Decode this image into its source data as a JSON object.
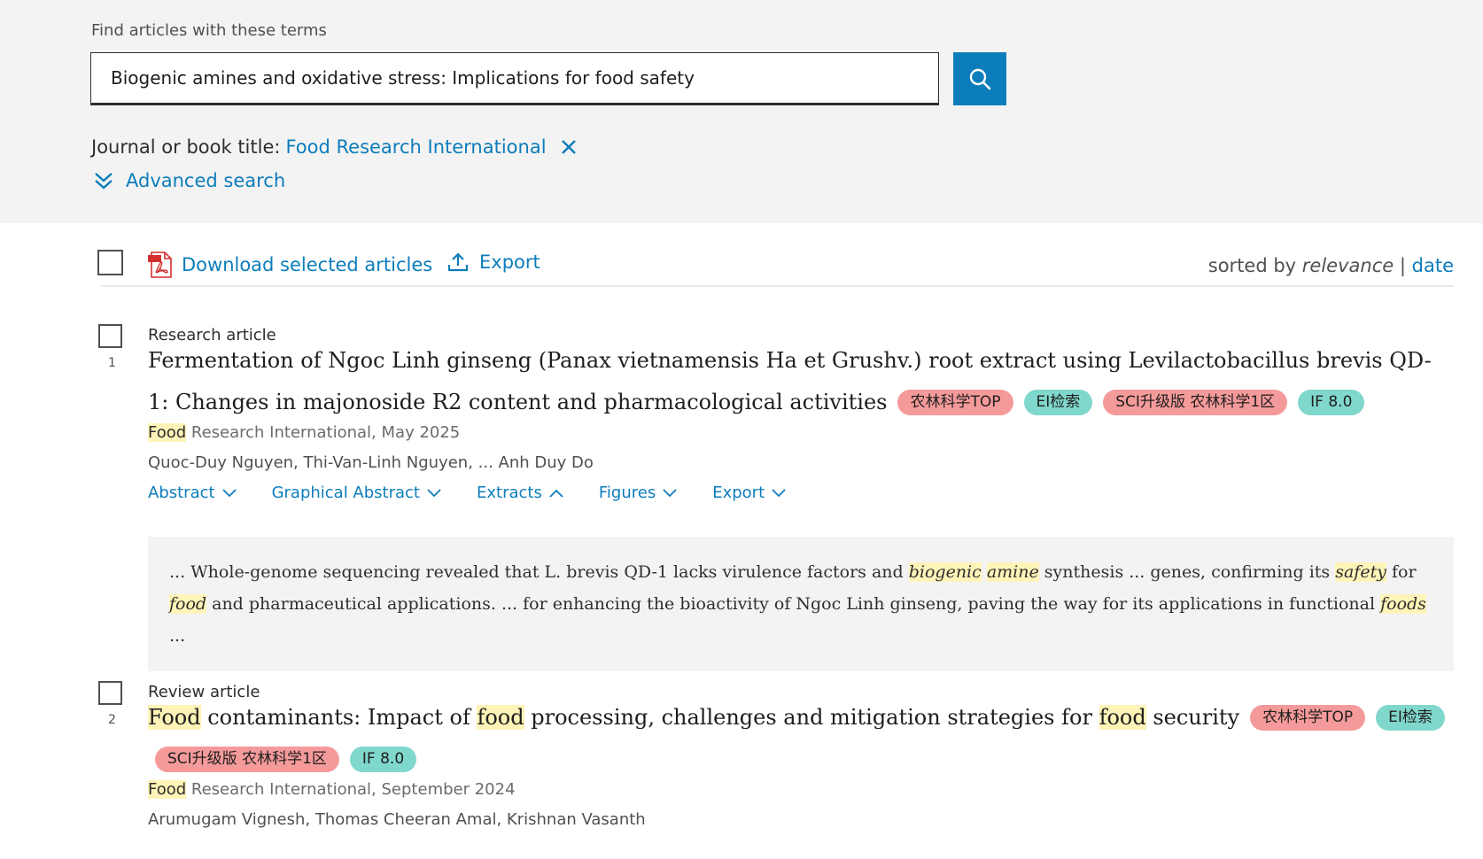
{
  "search": {
    "label": "Find articles with these terms",
    "value": "Biogenic amines and oxidative stress: Implications for food safety"
  },
  "filter": {
    "label": "Journal or book title:",
    "value": "Food Research International"
  },
  "advanced_search": "Advanced search",
  "toolbar": {
    "download": "Download selected articles",
    "export": "Export",
    "sorted_by": "sorted by",
    "relevance": "relevance",
    "separator": "|",
    "date": "date"
  },
  "results": [
    {
      "number": "1",
      "type": "Research article",
      "title": "Fermentation of Ngoc Linh ginseng (Panax vietnamensis Ha et Grushv.) root extract using Levilactobacillus brevis QD-1: Changes in majonoside R2 content and pharmacological activities",
      "badges": [
        "农林科学TOP",
        "EI检索",
        "SCI升级版 农林科学1区",
        "IF 8.0"
      ],
      "source_hl": "Food",
      "source_rest": " Research International, May 2025",
      "authors": "Quoc-Duy Nguyen, Thi-Van-Linh Nguyen, ... Anh Duy Do",
      "tabs": [
        "Abstract",
        "Graphical Abstract",
        "Extracts",
        "Figures",
        "Export"
      ],
      "extract": {
        "p1": "... Whole-genome sequencing revealed that L. brevis QD-1 lacks virulence factors and ",
        "h1": "biogenic",
        "s1": " ",
        "h2": "amine",
        "p2": " synthesis ... genes, confirming its ",
        "h3": "safety",
        "p3": " for ",
        "h4": "food",
        "p4": " and pharmaceutical applications. ... for enhancing the bioactivity of Ngoc Linh ginseng, paving the way for its applications in functional ",
        "h5": "foods",
        "p5": " ..."
      }
    },
    {
      "number": "2",
      "type": "Review article",
      "title_parts": [
        "Food",
        " contaminants: Impact of ",
        "food",
        " processing, challenges and mitigation strategies for ",
        "food",
        " security"
      ],
      "badges": [
        "农林科学TOP",
        "EI检索",
        "SCI升级版 农林科学1区",
        "IF 8.0"
      ],
      "source_hl": "Food",
      "source_rest": " Research International, September 2024",
      "authors": "Arumugam Vignesh, Thomas Cheeran Amal, Krishnan Vasanth"
    }
  ],
  "colors": {
    "accent": "#0c7dbb",
    "panel": "#f3f3f3",
    "highlight": "#fff4b8",
    "badge_red": "#f59a9a",
    "badge_teal": "#80d7cc"
  }
}
